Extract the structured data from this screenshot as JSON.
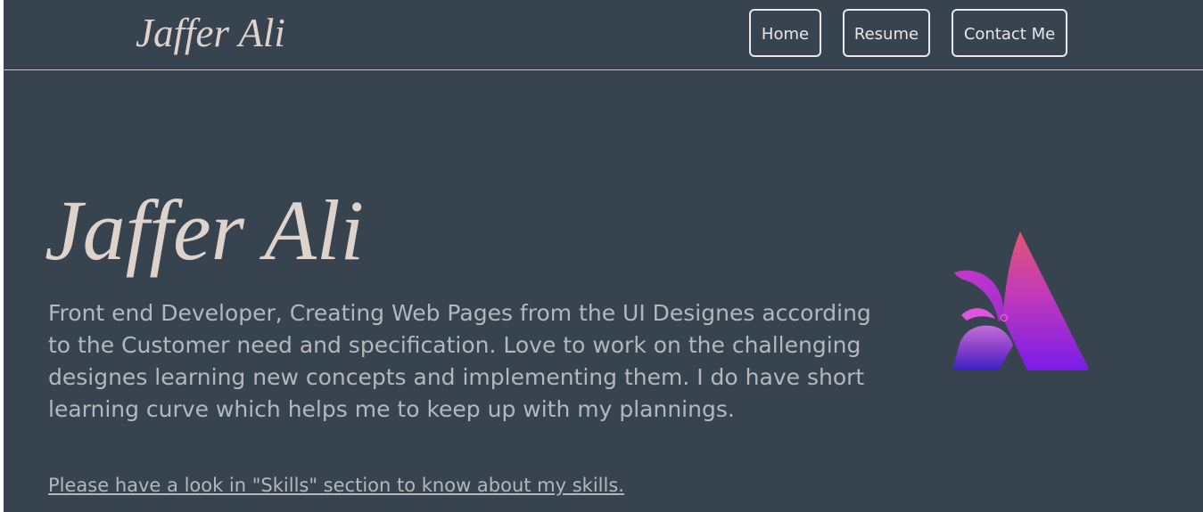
{
  "navbar": {
    "brand": "Jaffer Ali",
    "links": [
      {
        "label": "Home"
      },
      {
        "label": "Resume"
      },
      {
        "label": "Contact Me"
      }
    ]
  },
  "hero": {
    "name": "Jaffer Ali",
    "description": "Front end Developer, Creating Web Pages from the UI Designes according to the Customer need and specification. Love to work on the challenging designes learning new concepts and implementing them. I do have short learning curve which helps me to keep up with my plannings.",
    "skills_link": "Please have a look in \"Skills\" section to know about my skills.",
    "logo_icon": "gradient-letter-a-logo-icon"
  },
  "colors": {
    "background": "#37434f",
    "heading": "#ddd2cc",
    "body_text": "#b4b7bb",
    "button_border": "#e8e8e8",
    "logo_gradient": [
      "#e0527a",
      "#c23cc8",
      "#7b1ee8",
      "#3a22c8"
    ]
  }
}
